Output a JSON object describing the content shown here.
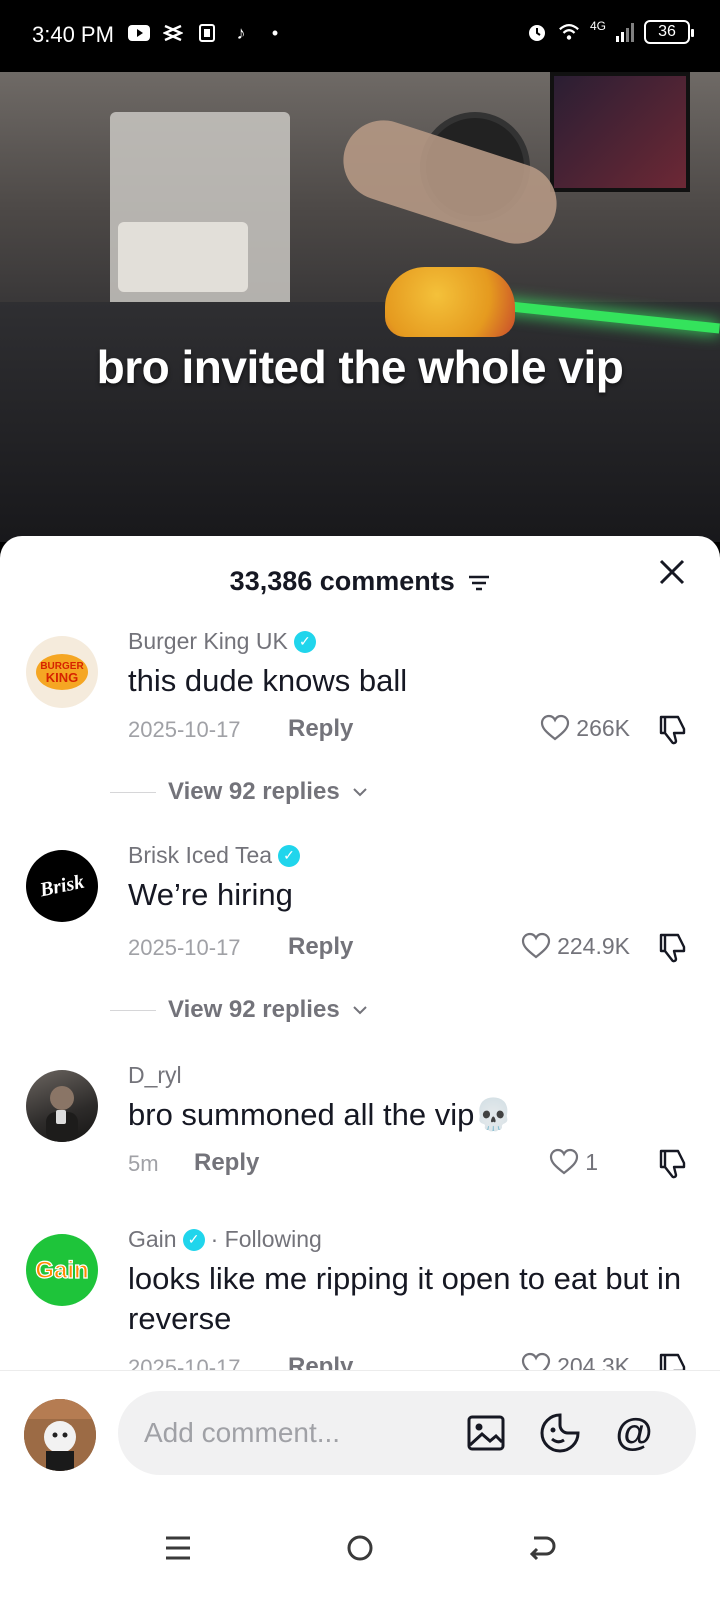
{
  "status": {
    "time": "3:40 PM",
    "network": "4G",
    "battery": "36"
  },
  "video": {
    "caption": "bro invited the whole vip"
  },
  "sheet": {
    "title": "33,386 comments"
  },
  "comments": [
    {
      "username": "Burger King UK",
      "verified": true,
      "text": "this dude knows ball",
      "date": "2025-10-17",
      "reply_label": "Reply",
      "likes": "266K",
      "view_replies": "View 92 replies",
      "avatar_text": "BURGER KING"
    },
    {
      "username": "Brisk Iced Tea",
      "verified": true,
      "text": "We’re hiring",
      "date": "2025-10-17",
      "reply_label": "Reply",
      "likes": "224.9K",
      "view_replies": "View 92 replies",
      "avatar_text": "Brisk"
    },
    {
      "username": "D_ryl",
      "verified": false,
      "text": "bro summoned all the vip💀",
      "date": "5m",
      "reply_label": "Reply",
      "likes": "1"
    },
    {
      "username": "Gain",
      "verified": true,
      "following": "· Following",
      "text": "looks like me ripping it open to eat but in reverse",
      "date": "2025-10-17",
      "reply_label": "Reply",
      "likes": "204.3K",
      "avatar_text": "Gain"
    }
  ],
  "input": {
    "placeholder": "Add comment..."
  }
}
